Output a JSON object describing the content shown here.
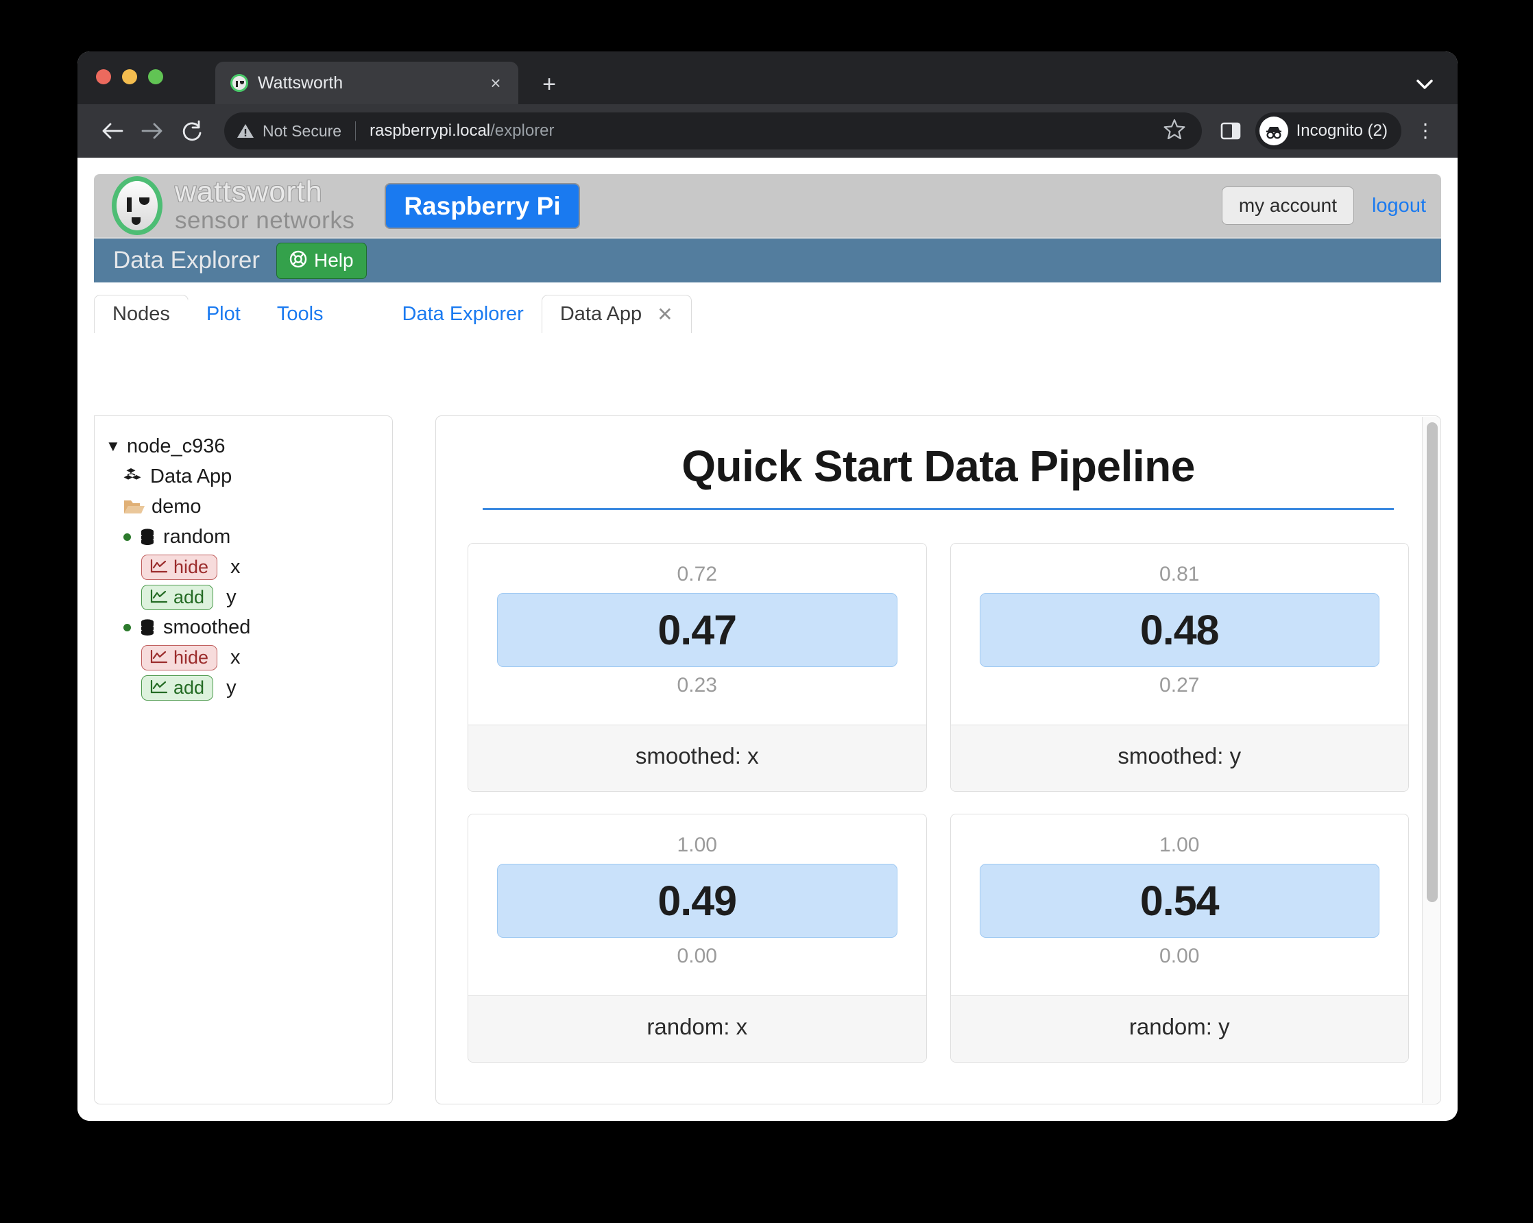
{
  "browser": {
    "tab": {
      "title": "Wattsworth",
      "favicon": "wattsworth-face-icon",
      "close": "×"
    },
    "new_tab": "+",
    "tabstrip_chevron": "⌄",
    "nav": {
      "back": "←",
      "forward": "→",
      "reload": "↻"
    },
    "omnibox": {
      "warning_label": "Not Secure",
      "url_host": "raspberrypi.local",
      "url_path": "/explorer",
      "star": "☆"
    },
    "profile": {
      "label": "Incognito (2)"
    },
    "menu": "⋮"
  },
  "site_header": {
    "brand_name": "wattsworth",
    "brand_sub": "sensor networks",
    "device_badge": "Raspberry Pi",
    "my_account": "my account",
    "logout": "logout"
  },
  "nav_bar": {
    "title": "Data Explorer",
    "help_label": "Help"
  },
  "tabs": {
    "left": [
      {
        "label": "Nodes",
        "active": true
      },
      {
        "label": "Plot",
        "active": false
      },
      {
        "label": "Tools",
        "active": false
      }
    ],
    "right": [
      {
        "label": "Data Explorer",
        "active": false,
        "closable": false
      },
      {
        "label": "Data App",
        "active": true,
        "closable": true
      }
    ],
    "close_glyph": "✕"
  },
  "sidebar": {
    "tree": [
      {
        "indent": 1,
        "caret": "▼",
        "icon": "",
        "label": "node_c936"
      },
      {
        "indent": 2,
        "caret": "",
        "icon": "cubes-icon",
        "label": "Data App"
      },
      {
        "indent": 3,
        "caret": "",
        "icon": "folder-open-icon",
        "label": "demo"
      },
      {
        "indent": 4,
        "caret": "",
        "icon": "database-icon",
        "status": "online",
        "label": "random"
      },
      {
        "indent": 5,
        "chip": "hide",
        "chip_label": "hide",
        "label": "x"
      },
      {
        "indent": 5,
        "chip": "add",
        "chip_label": "add",
        "label": "y"
      },
      {
        "indent": 4,
        "caret": "",
        "icon": "database-icon",
        "status": "online",
        "label": "smoothed"
      },
      {
        "indent": 5,
        "chip": "hide",
        "chip_label": "hide",
        "label": "x"
      },
      {
        "indent": 5,
        "chip": "add",
        "chip_label": "add",
        "label": "y"
      }
    ]
  },
  "data_app": {
    "title": "Quick Start Data Pipeline",
    "gauges": [
      {
        "max": "0.72",
        "value": "0.47",
        "min": "0.23",
        "label": "smoothed: x"
      },
      {
        "max": "0.81",
        "value": "0.48",
        "min": "0.27",
        "label": "smoothed: y"
      },
      {
        "max": "1.00",
        "value": "0.49",
        "min": "0.00",
        "label": "random: x"
      },
      {
        "max": "1.00",
        "value": "0.54",
        "min": "0.00",
        "label": "random: y"
      }
    ]
  },
  "colors": {
    "accent_blue": "#1a7af0",
    "nav_bar": "#537d9e",
    "help_green": "#34a14b",
    "gauge_fill": "#c9e1fa",
    "brand_green": "#4dbd74"
  }
}
